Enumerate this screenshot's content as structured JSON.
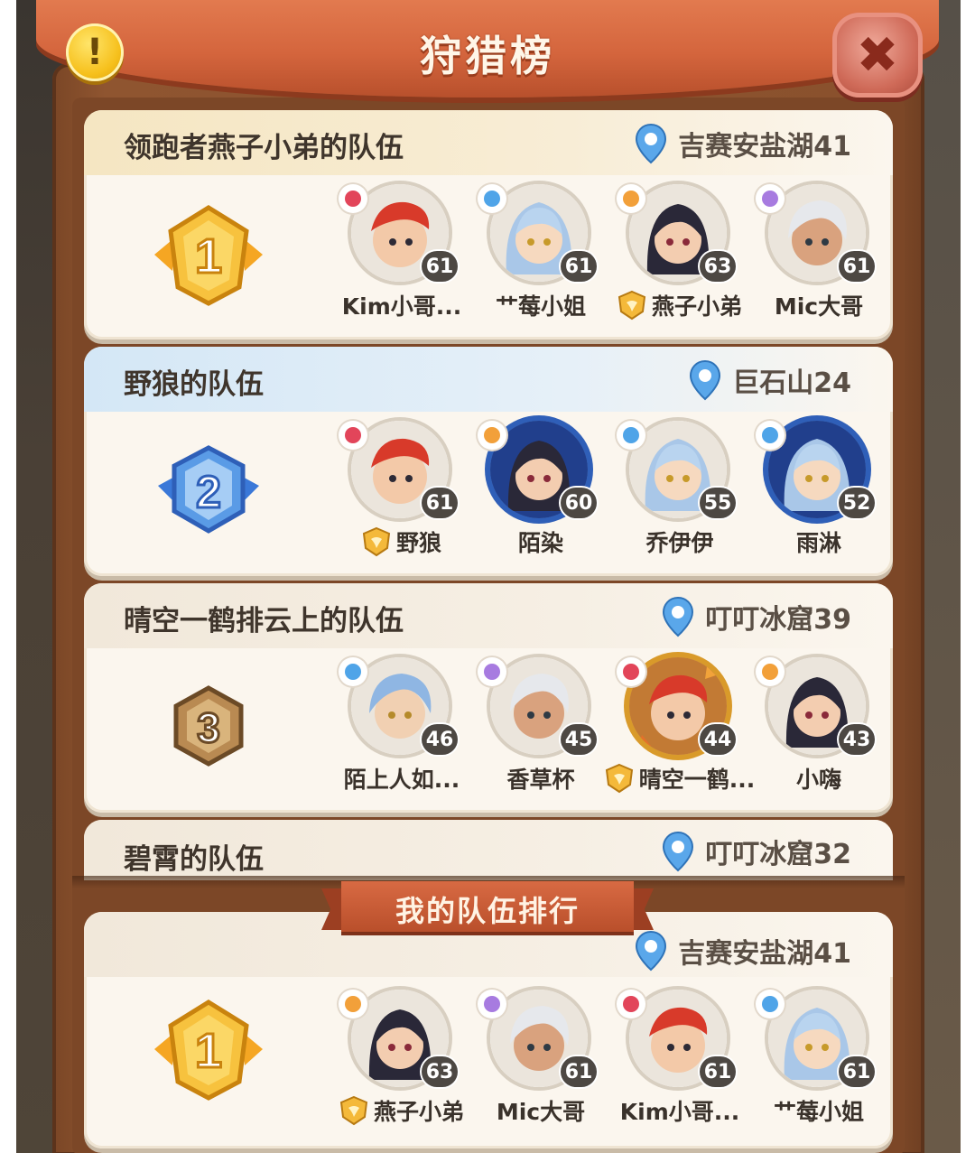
{
  "title": "狩猎榜",
  "teams": [
    {
      "name": "领跑者燕子小弟的队伍",
      "location": "吉赛安盐湖41",
      "rank": "1",
      "members": [
        {
          "name": "Kim小哥...",
          "level": "61",
          "captain": false
        },
        {
          "name": "艹莓小姐",
          "level": "61",
          "captain": false
        },
        {
          "name": "燕子小弟",
          "level": "63",
          "captain": true
        },
        {
          "name": "Mic大哥",
          "level": "61",
          "captain": false
        }
      ]
    },
    {
      "name": "野狼的队伍",
      "location": "巨石山24",
      "rank": "2",
      "members": [
        {
          "name": "野狼",
          "level": "61",
          "captain": true
        },
        {
          "name": "陌染",
          "level": "60",
          "captain": false
        },
        {
          "name": "乔伊伊",
          "level": "55",
          "captain": false
        },
        {
          "name": "雨淋",
          "level": "52",
          "captain": false
        }
      ]
    },
    {
      "name": "晴空一鹤排云上的队伍",
      "location": "叮叮冰窟39",
      "rank": "3",
      "members": [
        {
          "name": "陌上人如...",
          "level": "46",
          "captain": false
        },
        {
          "name": "香草杯",
          "level": "45",
          "captain": false
        },
        {
          "name": "晴空一鹤...",
          "level": "44",
          "captain": true
        },
        {
          "name": "小嗨",
          "level": "43",
          "captain": false
        }
      ]
    },
    {
      "name": "碧霄的队伍",
      "location": "叮叮冰窟32"
    }
  ],
  "my_team": {
    "section_label": "我的队伍排行",
    "location": "吉赛安盐湖41",
    "rank": "1",
    "members": [
      {
        "name": "燕子小弟",
        "level": "63",
        "captain": true
      },
      {
        "name": "Mic大哥",
        "level": "61",
        "captain": false
      },
      {
        "name": "Kim小哥...",
        "level": "61",
        "captain": false
      },
      {
        "name": "艹莓小姐",
        "level": "61",
        "captain": false
      }
    ]
  },
  "colors": {
    "gold": "#f4b93a",
    "silver_blue": "#5a9be6",
    "bronze": "#b98a52",
    "wood": "#8a512d",
    "banner": "#d4653d"
  }
}
